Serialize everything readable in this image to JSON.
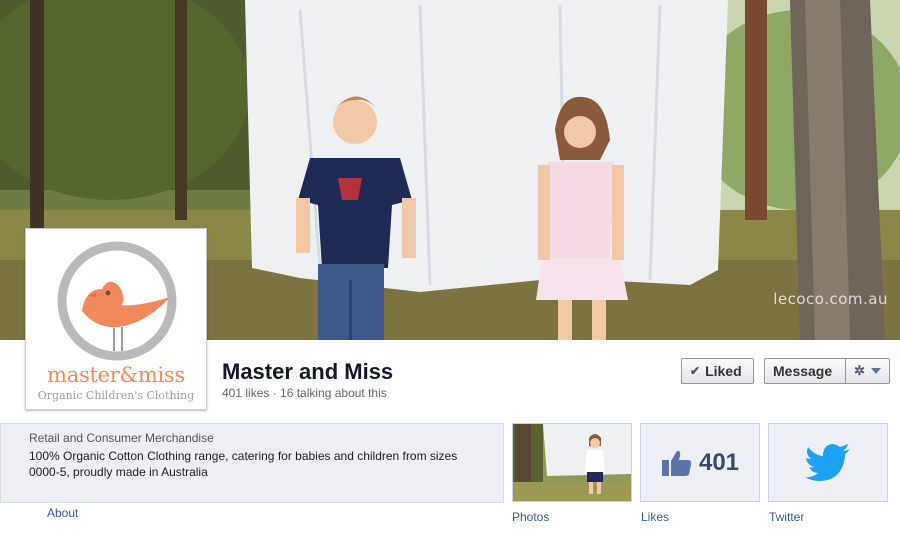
{
  "cover": {
    "watermark": "lecoco.com.au"
  },
  "profile": {
    "logo_word": "master&miss",
    "logo_tagline": "Organic Children's Clothing"
  },
  "page": {
    "name": "Master and Miss",
    "stats": "401 likes · 16 talking about this"
  },
  "actions": {
    "liked_label": "Liked",
    "message_label": "Message"
  },
  "about": {
    "category": "Retail and Consumer Merchandise",
    "description": "100% Organic Cotton Clothing range, catering for babies and children from sizes 0000-5, proudly made in Australia",
    "link_label": "About"
  },
  "tiles": {
    "photos_label": "Photos",
    "likes_label": "Likes",
    "likes_count": "401",
    "twitter_label": "Twitter"
  },
  "colors": {
    "link": "#3b5998",
    "brand_orange": "#f08a5d",
    "twitter_blue": "#1da1f2"
  }
}
